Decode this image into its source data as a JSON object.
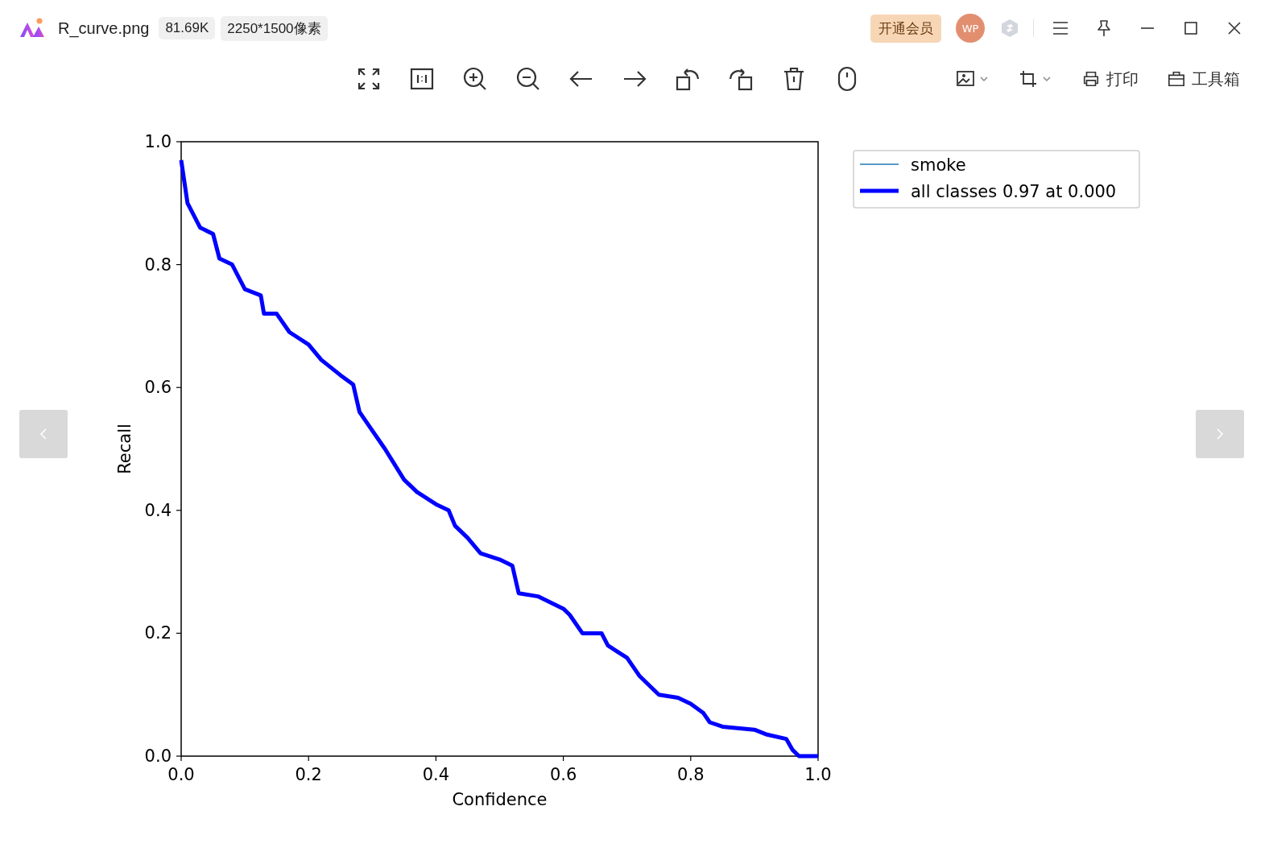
{
  "header": {
    "filename": "R_curve.png",
    "file_size": "81.69K",
    "dimensions": "2250*1500像素",
    "vip_button": "开通会员",
    "avatar": "WP"
  },
  "toolbar": {
    "print_button": "打印",
    "toolbox_button": "工具箱"
  },
  "chart_data": {
    "type": "line",
    "xlabel": "Confidence",
    "ylabel": "Recall",
    "xlim": [
      0,
      1
    ],
    "ylim": [
      0,
      1
    ],
    "xticks": [
      {
        "value": 0,
        "label": "0.0"
      },
      {
        "value": 0.2,
        "label": "0.2"
      },
      {
        "value": 0.4,
        "label": "0.4"
      },
      {
        "value": 0.6,
        "label": "0.6"
      },
      {
        "value": 0.8,
        "label": "0.8"
      },
      {
        "value": 1,
        "label": "1.0"
      }
    ],
    "yticks": [
      {
        "value": 0,
        "label": "0.0"
      },
      {
        "value": 0.2,
        "label": "0.2"
      },
      {
        "value": 0.4,
        "label": "0.4"
      },
      {
        "value": 0.6,
        "label": "0.6"
      },
      {
        "value": 0.8,
        "label": "0.8"
      },
      {
        "value": 1,
        "label": "1.0"
      }
    ],
    "x": [
      0,
      0.01,
      0.02,
      0.03,
      0.05,
      0.06,
      0.08,
      0.1,
      0.125,
      0.13,
      0.15,
      0.17,
      0.2,
      0.22,
      0.25,
      0.27,
      0.28,
      0.3,
      0.32,
      0.35,
      0.37,
      0.4,
      0.42,
      0.43,
      0.45,
      0.47,
      0.5,
      0.52,
      0.53,
      0.56,
      0.58,
      0.6,
      0.61,
      0.63,
      0.66,
      0.67,
      0.7,
      0.72,
      0.75,
      0.78,
      0.8,
      0.82,
      0.83,
      0.85,
      0.9,
      0.92,
      0.95,
      0.96,
      0.97,
      1
    ],
    "legend": [
      {
        "label": "smoke",
        "color": "#1f77b4"
      }
    ],
    "series": [
      {
        "name": "all classes 0.97 at 0.000",
        "color": "#0000ff",
        "values": [
          0.97,
          0.9,
          0.88,
          0.86,
          0.85,
          0.81,
          0.8,
          0.76,
          0.75,
          0.72,
          0.72,
          0.69,
          0.67,
          0.645,
          0.62,
          0.605,
          0.56,
          0.53,
          0.5,
          0.45,
          0.43,
          0.41,
          0.4,
          0.375,
          0.355,
          0.33,
          0.32,
          0.31,
          0.265,
          0.26,
          0.25,
          0.24,
          0.23,
          0.2,
          0.2,
          0.18,
          0.16,
          0.13,
          0.1,
          0.095,
          0.085,
          0.07,
          0.055,
          0.048,
          0.043,
          0.035,
          0.028,
          0.01,
          0,
          0
        ]
      }
    ]
  }
}
